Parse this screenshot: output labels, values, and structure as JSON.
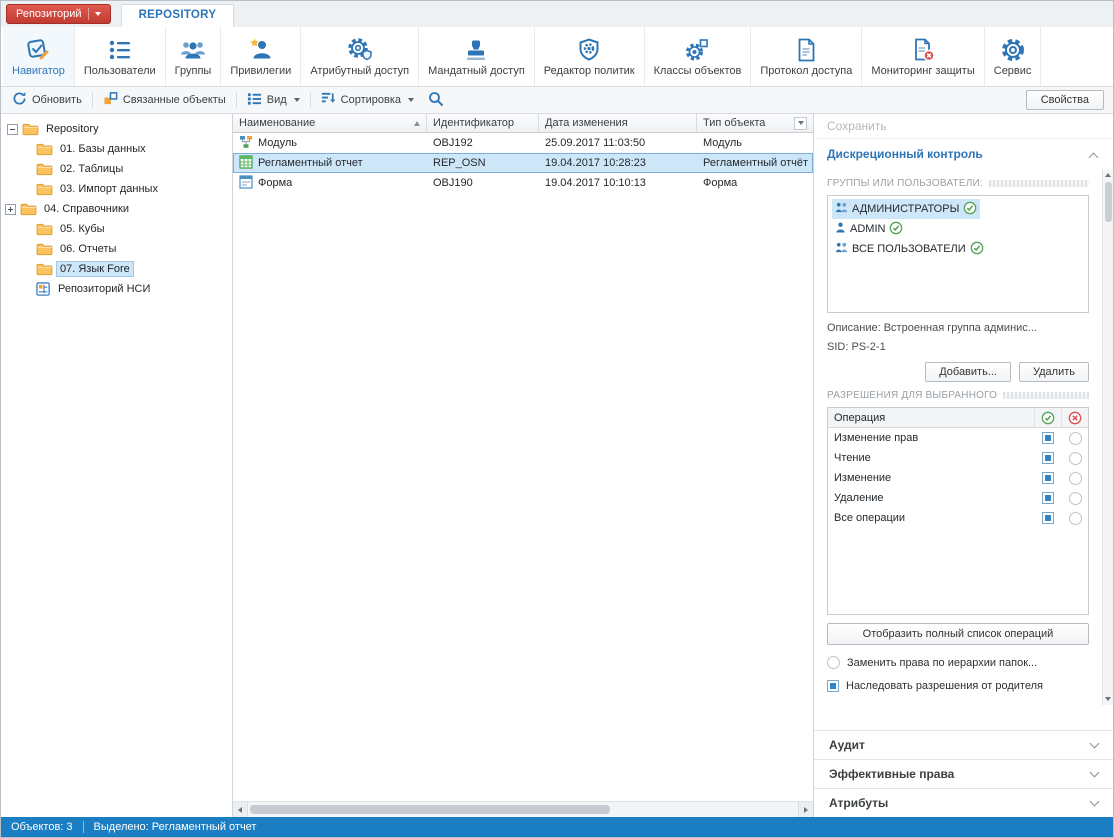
{
  "app": {
    "repo_button": "Репозиторий",
    "tab": "REPOSITORY"
  },
  "ribbon": {
    "items": [
      {
        "label": "Навигатор",
        "icon": "navigator-icon",
        "active": true
      },
      {
        "label": "Пользователи",
        "icon": "users-list-icon"
      },
      {
        "label": "Группы",
        "icon": "groups-icon"
      },
      {
        "label": "Привилегии",
        "icon": "privileges-icon"
      },
      {
        "label": "Атрибутный доступ",
        "icon": "attribute-access-icon"
      },
      {
        "label": "Мандатный доступ",
        "icon": "mandatory-access-icon"
      },
      {
        "label": "Редактор политик",
        "icon": "policy-editor-icon"
      },
      {
        "label": "Классы объектов",
        "icon": "object-classes-icon"
      },
      {
        "label": "Протокол доступа",
        "icon": "access-log-icon"
      },
      {
        "label": "Мониторинг защиты",
        "icon": "security-monitoring-icon"
      },
      {
        "label": "Сервис",
        "icon": "service-gear-icon"
      }
    ]
  },
  "toolbar": {
    "refresh_label": "Обновить",
    "related_label": "Связанные объекты",
    "view_label": "Вид",
    "sort_label": "Сортировка",
    "properties_label": "Свойства"
  },
  "tree": {
    "root_label": "Repository",
    "items": [
      {
        "label": "01. Базы данных",
        "icon": "folder-icon"
      },
      {
        "label": "02. Таблицы",
        "icon": "folder-icon"
      },
      {
        "label": "03. Импорт данных",
        "icon": "folder-icon"
      },
      {
        "label": "04. Справочники",
        "icon": "folder-icon",
        "expandable": true
      },
      {
        "label": "05. Кубы",
        "icon": "folder-icon"
      },
      {
        "label": "06. Отчеты",
        "icon": "folder-icon"
      },
      {
        "label": "07. Язык Fore",
        "icon": "folder-icon",
        "selected": true
      },
      {
        "label": "Репозиторий НСИ",
        "icon": "nsi-repository-icon"
      }
    ]
  },
  "table": {
    "columns": [
      "Наименование",
      "Идентификатор",
      "Дата изменения",
      "Тип объекта"
    ],
    "rows": [
      {
        "name": "Модуль",
        "id": "OBJ192",
        "date": "25.09.2017 11:03:50",
        "type": "Модуль",
        "icon": "module-icon"
      },
      {
        "name": "Регламентный отчет",
        "id": "REP_OSN",
        "date": "19.04.2017 10:28:23",
        "type": "Регламентный отчёт",
        "icon": "report-icon",
        "selected": true
      },
      {
        "name": "Форма",
        "id": "OBJ190",
        "date": "19.04.2017 10:10:13",
        "type": "Форма",
        "icon": "form-icon"
      }
    ]
  },
  "properties": {
    "save_label": "Сохранить",
    "sections": {
      "discretionary": "Дискреционный контроль",
      "audit": "Аудит",
      "effective": "Эффективные права",
      "attributes": "Атрибуты"
    },
    "groups_label": "ГРУППЫ ИЛИ ПОЛЬЗОВАТЕЛИ:",
    "groups": [
      {
        "label": "АДМИНИСТРАТОРЫ",
        "icon": "group-icon",
        "checked": true,
        "selected": true
      },
      {
        "label": "ADMIN",
        "icon": "user-icon",
        "checked": true
      },
      {
        "label": "ВСЕ ПОЛЬЗОВАТЕЛИ",
        "icon": "group-icon",
        "checked": true
      }
    ],
    "description": "Описание: Встроенная группа админис...",
    "sid": "SID: PS-2-1",
    "add_button": "Добавить...",
    "delete_button": "Удалить",
    "permissions_label": "РАЗРЕШЕНИЯ ДЛЯ ВЫБРАННОГО",
    "operations_header": "Операция",
    "operations": [
      {
        "label": "Изменение прав",
        "allow": true,
        "deny": false
      },
      {
        "label": "Чтение",
        "allow": true,
        "deny": false
      },
      {
        "label": "Изменение",
        "allow": true,
        "deny": false
      },
      {
        "label": "Удаление",
        "allow": true,
        "deny": false
      },
      {
        "label": "Все операции",
        "allow": true,
        "deny": false
      }
    ],
    "full_list_button": "Отобразить полный список операций",
    "replace_checkbox": {
      "label": "Заменить права по иерархии папок...",
      "checked": false
    },
    "inherit_checkbox": {
      "label": "Наследовать разрешения от родителя",
      "checked": true
    }
  },
  "statusbar": {
    "objects": "Объектов: 3",
    "selected": "Выделено: Регламентный отчет"
  },
  "colors": {
    "accent_blue": "#2e75b6",
    "selection_blue": "#cde7f8",
    "status_bar": "#1b7ec2",
    "repo_button_red": "#c23b31",
    "allow_check": "#2e86c9",
    "ok_green": "#57a45b",
    "deny_red": "#d9534f",
    "folder_yellow": "#fcc45f"
  }
}
